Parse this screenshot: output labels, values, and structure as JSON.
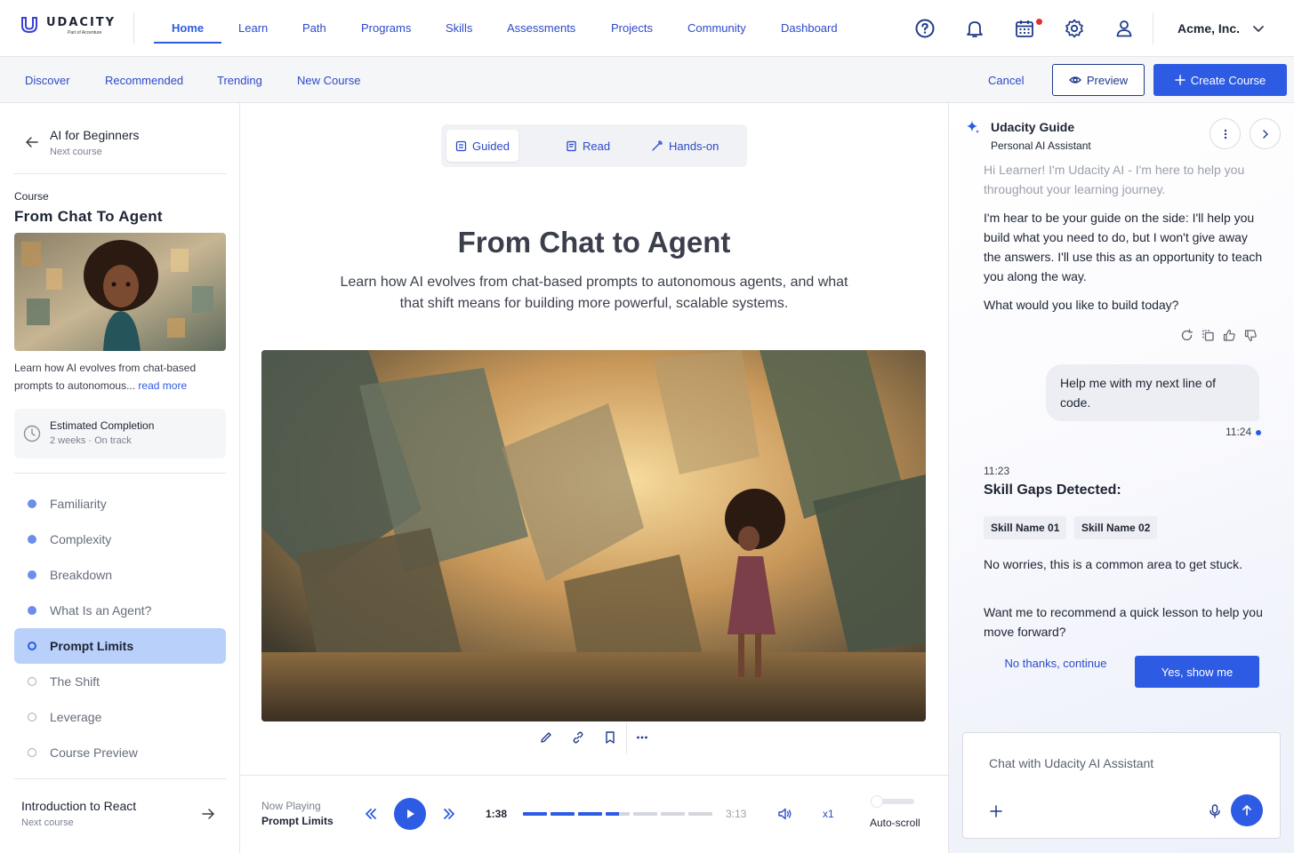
{
  "brand": {
    "name": "UDACITY",
    "sub": "Part of Accenture"
  },
  "nav": {
    "items": [
      "Home",
      "Learn",
      "Path",
      "Programs",
      "Skills",
      "Assessments",
      "Projects",
      "Community",
      "Dashboard"
    ],
    "active": "Home"
  },
  "header": {
    "icons": [
      "help-icon",
      "bell-icon",
      "calendar-icon",
      "gear-icon",
      "user-icon",
      "chevron-down-icon"
    ],
    "org": "Acme, Inc."
  },
  "subnav": {
    "items": [
      "Discover",
      "Recommended",
      "Trending",
      "New Course"
    ],
    "cancel": "Cancel",
    "preview": "Preview",
    "create": "Create Course"
  },
  "sidebar": {
    "prev": {
      "title": "AI for Beginners",
      "sub": "Next course"
    },
    "course_kicker": "Course",
    "course_title": "From Chat To Agent",
    "desc": "Learn how AI evolves from chat-based prompts to autonomous...",
    "read_more": "read more",
    "estimate": {
      "title": "Estimated Completion",
      "sub": "2 weeks · On track"
    },
    "lessons": [
      {
        "label": "Familiarity",
        "state": "done"
      },
      {
        "label": "Complexity",
        "state": "done"
      },
      {
        "label": "Breakdown",
        "state": "done"
      },
      {
        "label": "What Is an Agent?",
        "state": "done"
      },
      {
        "label": "Prompt Limits",
        "state": "active"
      },
      {
        "label": "The Shift",
        "state": "todo"
      },
      {
        "label": "Leverage",
        "state": "todo"
      },
      {
        "label": "Course Preview",
        "state": "todo"
      }
    ],
    "next": {
      "title": "Introduction to React",
      "sub": "Next course"
    }
  },
  "main": {
    "modes": [
      "Guided",
      "Read",
      "Hands-on"
    ],
    "active_mode": "Guided",
    "title": "From Chat to Agent",
    "desc": "Learn how AI evolves from chat-based prompts to autonomous agents, and what that shift means for building more powerful, scalable systems.",
    "image_tools": [
      "pencil-icon",
      "link-icon",
      "bookmark-icon",
      "more-icon"
    ]
  },
  "player": {
    "now_label": "Now Playing",
    "now_title": "Prompt Limits",
    "elapsed": "1:38",
    "duration": "3:13",
    "progress": 0.507,
    "speed": "x1",
    "autoscroll": "Auto-scroll"
  },
  "assistant": {
    "title": "Udacity Guide",
    "sub": "Personal AI Assistant",
    "messages": [
      "Hi Learner! I'm Udacity AI - I'm here to help you throughout your learning journey.",
      "I'm hear to be your guide on the side: I'll help you build what you need to do, but I won't give away the answers. I'll use this as an opportunity to teach you along the way.",
      "What would you like to build today?"
    ],
    "user_msg": "Help me with my next line of code.",
    "user_time": "11:24",
    "ai_time": "11:23",
    "gap_title": "Skill Gaps Detected:",
    "chips": [
      "Skill Name 01",
      "Skill Name 02"
    ],
    "reply1": "No worries, this is a common area to get stuck.",
    "reply2": "Want me to recommend a quick lesson to help you move forward?",
    "no_btn": "No thanks, continue",
    "yes_btn": "Yes, show me",
    "placeholder": "Chat with Udacity AI Assistant"
  },
  "colors": {
    "accent": "#2d5be3",
    "active_lesson": "#b9d0fb",
    "nav_text": "#2c4ac9"
  }
}
